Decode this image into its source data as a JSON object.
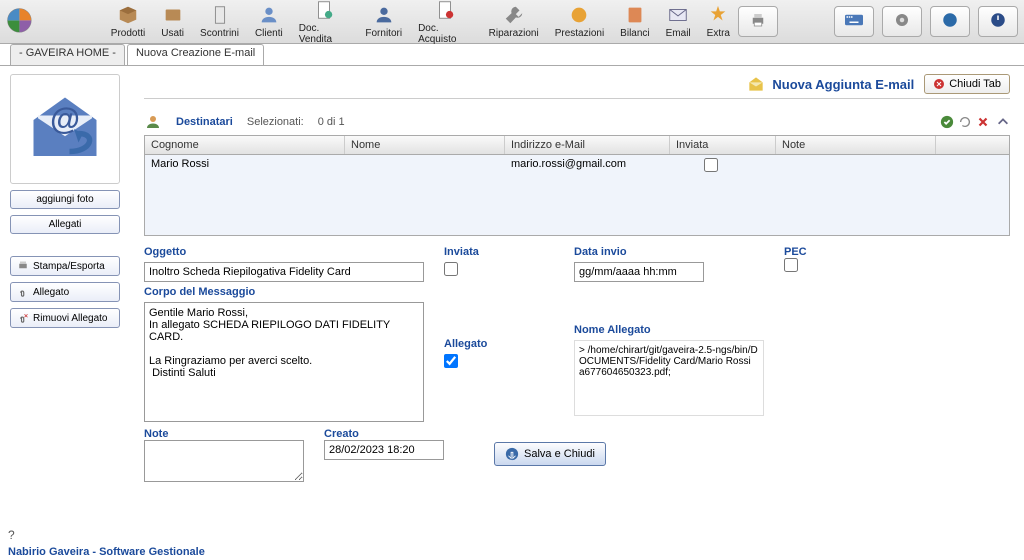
{
  "toolbar": {
    "items": [
      {
        "label": "Prodotti"
      },
      {
        "label": "Usati"
      },
      {
        "label": "Scontrini"
      },
      {
        "label": "Clienti"
      },
      {
        "label": "Doc. Vendita"
      },
      {
        "label": "Fornitori"
      },
      {
        "label": "Doc. Acquisto"
      },
      {
        "label": "Riparazioni"
      },
      {
        "label": "Prestazioni"
      },
      {
        "label": "Bilanci"
      },
      {
        "label": "Email"
      },
      {
        "label": "Extra"
      }
    ]
  },
  "tabs": {
    "home": "- GAVEIRA HOME -",
    "current": "Nuova Creazione E-mail"
  },
  "sidebar": {
    "add_photo": "aggiungi foto",
    "allegati": "Allegati",
    "stampa": "Stampa/Esporta",
    "allegato": "Allegato",
    "rimuovi": "Rimuovi Allegato"
  },
  "header": {
    "title": "Nuova Aggiunta E-mail",
    "close": "Chiudi Tab"
  },
  "dest": {
    "label": "Destinatari",
    "sel_label": "Selezionati:",
    "sel_value": "0 di 1"
  },
  "grid": {
    "cols": {
      "cognome": "Cognome",
      "nome": "Nome",
      "email": "Indirizzo e-Mail",
      "inviata": "Inviata",
      "note": "Note"
    },
    "rows": [
      {
        "cognome": "Mario Rossi",
        "nome": "",
        "email": "mario.rossi@gmail.com",
        "inviata": false,
        "note": ""
      }
    ]
  },
  "form": {
    "oggetto_lbl": "Oggetto",
    "oggetto_val": "Inoltro Scheda Riepilogativa Fidelity Card",
    "corpo_lbl": "Corpo del Messaggio",
    "corpo_val": "Gentile Mario Rossi,\nIn allegato SCHEDA RIEPILOGO DATI FIDELITY CARD.\n\nLa Ringraziamo per averci scelto.\n Distinti Saluti",
    "inviata_lbl": "Inviata",
    "allegato_lbl": "Allegato",
    "data_invio_lbl": "Data invio",
    "data_invio_val": "gg/mm/aaaa hh:mm",
    "pec_lbl": "PEC",
    "nome_allegato_lbl": "Nome Allegato",
    "nome_allegato_val": "> /home/chirart/git/gaveira-2.5-ngs/bin/DOCUMENTS/Fidelity Card/Mario Rossi a677604650323.pdf;",
    "note_lbl": "Note",
    "creato_lbl": "Creato",
    "creato_val": "28/02/2023 18:20",
    "save": "Salva e Chiudi"
  },
  "footer": "Nabirio Gaveira - Software Gestionale"
}
